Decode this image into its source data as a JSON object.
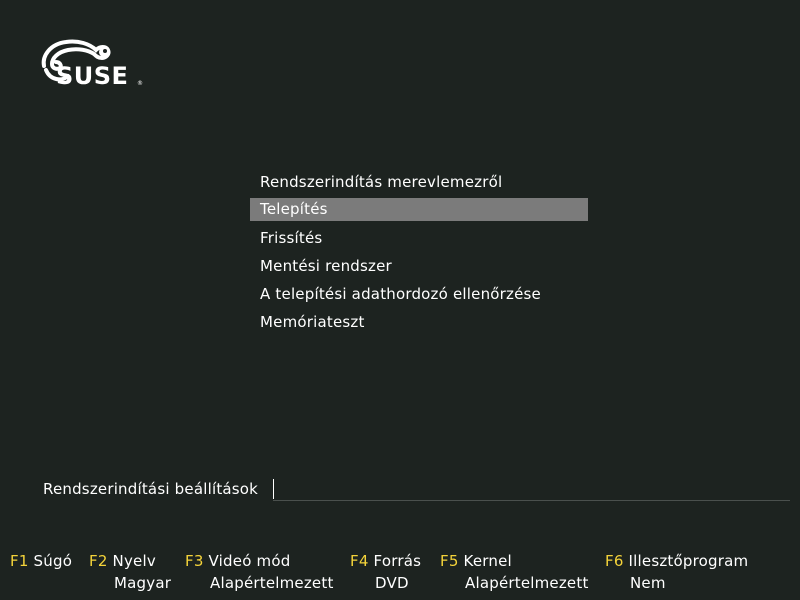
{
  "logo": {
    "text": "SUSE",
    "registered": "®"
  },
  "menu": {
    "items": [
      {
        "label": "Rendszerindítás merevlemezről",
        "selected": false
      },
      {
        "label": "Telepítés",
        "selected": true
      },
      {
        "label": "Frissítés",
        "selected": false
      },
      {
        "label": "Mentési rendszer",
        "selected": false
      },
      {
        "label": "A telepítési adathordozó ellenőrzése",
        "selected": false
      },
      {
        "label": "Memóriateszt",
        "selected": false
      }
    ]
  },
  "boot_options": {
    "label": "Rendszerindítási beállítások",
    "value": ""
  },
  "fkeys": [
    {
      "key": "F1",
      "label": "Súgó",
      "value": ""
    },
    {
      "key": "F2",
      "label": "Nyelv",
      "value": "Magyar"
    },
    {
      "key": "F3",
      "label": "Videó mód",
      "value": "Alapértelmezett"
    },
    {
      "key": "F4",
      "label": "Forrás",
      "value": "DVD"
    },
    {
      "key": "F5",
      "label": "Kernel",
      "value": "Alapértelmezett"
    },
    {
      "key": "F6",
      "label": "Illesztőprogram",
      "value": "Nem"
    }
  ],
  "colors": {
    "background": "#1d2320",
    "selection": "#7b7b7b",
    "fkey_accent": "#f4d33a"
  }
}
